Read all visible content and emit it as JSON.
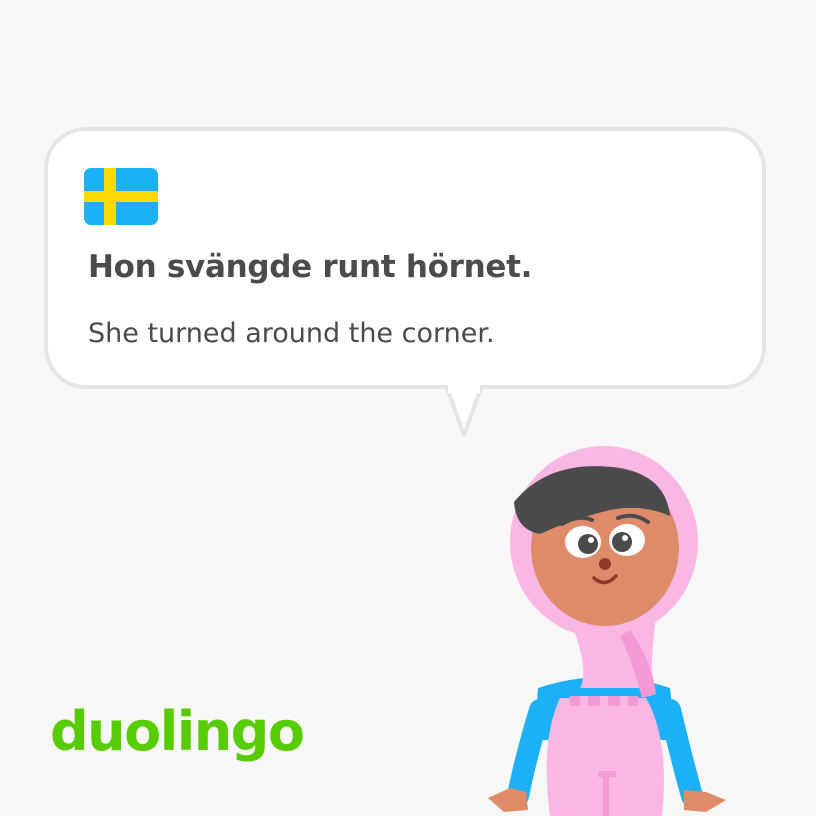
{
  "card": {
    "flag_icon": "sweden-flag-icon",
    "sentence": "Hon svängde runt hörnet.",
    "translation": "She turned around the corner."
  },
  "brand": {
    "logo_text": "duolingo"
  },
  "colors": {
    "background": "#f7f7f7",
    "bubble_border": "#e5e5e5",
    "text": "#4b4b4b",
    "brand_green": "#58cc02",
    "flag_blue": "#1cb0f6",
    "flag_yellow": "#ffd900",
    "hijab_pink": "#f9b8e4",
    "skin": "#de8b6a",
    "shirt_blue": "#1cb0f6"
  },
  "character": {
    "icon": "hijab-woman-character-icon"
  }
}
